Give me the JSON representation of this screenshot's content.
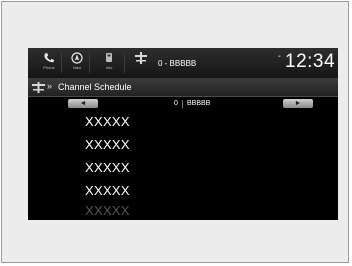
{
  "status_bar": {
    "icons": [
      {
        "icon": "phone-icon",
        "caption": "Phone"
      },
      {
        "icon": "navigation-icon",
        "caption": "Navi"
      },
      {
        "icon": "audio-icon",
        "caption": "Info"
      },
      {
        "icon": "satellite-radio-icon",
        "caption": ""
      }
    ],
    "now_playing": "0 - BBBBB",
    "clock": "12:34"
  },
  "title_bar": {
    "icon": "satellite-radio-icon",
    "chevron": "»",
    "title": "Channel Schedule"
  },
  "channel_nav": {
    "prev_symbol": "◄",
    "next_symbol": "►",
    "channel_number": "0",
    "channel_name": "BBBBB"
  },
  "schedule": {
    "items": [
      "XXXXX",
      "XXXXX",
      "XXXXX",
      "XXXXX",
      "XXXXX"
    ]
  }
}
